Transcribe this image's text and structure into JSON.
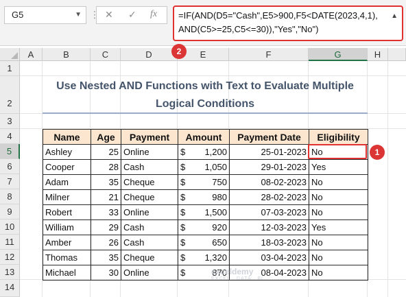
{
  "formula_bar": {
    "name_box": "G5",
    "cancel_symbol": "✕",
    "enter_symbol": "✓",
    "fx_symbol": "fx",
    "formula": "=IF(AND(D5=\"Cash\",E5>900,F5<DATE(2023,4,1),AND(C5>=25,C5<=30)),\"Yes\",\"No\")"
  },
  "callouts": {
    "formula": "2",
    "cell": "1"
  },
  "columns": [
    "A",
    "B",
    "C",
    "D",
    "E",
    "F",
    "G",
    "H"
  ],
  "selected_column": "G",
  "rows": [
    "1",
    "2",
    "3",
    "4",
    "5",
    "6",
    "7",
    "8",
    "9",
    "10",
    "11",
    "12",
    "13",
    "14"
  ],
  "selected_row": "5",
  "sheet": {
    "title": "Use Nested AND Functions with Text to Evaluate Multiple Logical Conditions"
  },
  "table": {
    "headers": [
      "Name",
      "Age",
      "Payment",
      "Amount",
      "Payment Date",
      "Eligibility"
    ],
    "currency_symbol": "$",
    "rows": [
      [
        "Ashley",
        "25",
        "Online",
        "1,200",
        "25-01-2023",
        "No"
      ],
      [
        "Cooper",
        "28",
        "Cash",
        "1,050",
        "29-01-2023",
        "Yes"
      ],
      [
        "Adam",
        "35",
        "Cheque",
        "750",
        "08-02-2023",
        "No"
      ],
      [
        "Milner",
        "21",
        "Cheque",
        "980",
        "28-02-2023",
        "No"
      ],
      [
        "Robert",
        "33",
        "Online",
        "1,500",
        "07-03-2023",
        "No"
      ],
      [
        "William",
        "29",
        "Cash",
        "920",
        "12-03-2023",
        "Yes"
      ],
      [
        "Amber",
        "26",
        "Cash",
        "650",
        "18-03-2023",
        "No"
      ],
      [
        "Thomas",
        "35",
        "Cheque",
        "1,320",
        "03-04-2023",
        "No"
      ],
      [
        "Michael",
        "30",
        "Online",
        "870",
        "08-04-2023",
        "No"
      ]
    ]
  },
  "watermark": {
    "brand": "exceldemy",
    "tagline": "EXCEL · DATA · BI"
  }
}
